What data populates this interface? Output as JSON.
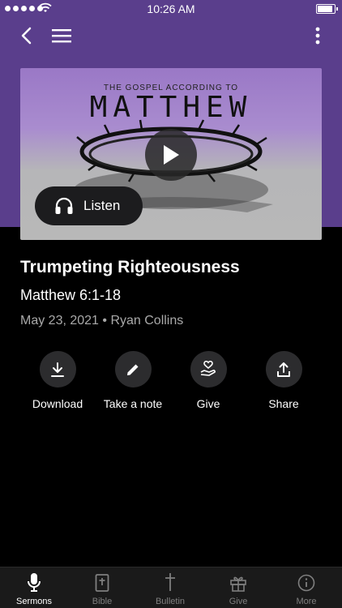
{
  "status_bar": {
    "time": "10:26 AM"
  },
  "artwork": {
    "subtitle": "THE GOSPEL ACCORDING TO",
    "title": "MATTHEW"
  },
  "listen_label": "Listen",
  "sermon": {
    "title": "Trumpeting Righteousness",
    "scripture": "Matthew 6:1-18",
    "meta": "May 23, 2021 • Ryan Collins"
  },
  "actions": [
    {
      "label": "Download",
      "icon": "download-icon"
    },
    {
      "label": "Take a note",
      "icon": "pencil-icon"
    },
    {
      "label": "Give",
      "icon": "heart-hand-icon"
    },
    {
      "label": "Share",
      "icon": "share-icon"
    }
  ],
  "tabs": [
    {
      "label": "Sermons",
      "icon": "microphone-icon",
      "active": true
    },
    {
      "label": "Bible",
      "icon": "bible-icon",
      "active": false
    },
    {
      "label": "Bulletin",
      "icon": "cross-icon",
      "active": false
    },
    {
      "label": "Give",
      "icon": "gift-icon",
      "active": false
    },
    {
      "label": "More",
      "icon": "info-icon",
      "active": false
    }
  ],
  "colors": {
    "header_purple": "#5a3e8c",
    "background": "#000000",
    "action_circle": "#2c2c2e",
    "tab_inactive": "#7f7f7f"
  }
}
